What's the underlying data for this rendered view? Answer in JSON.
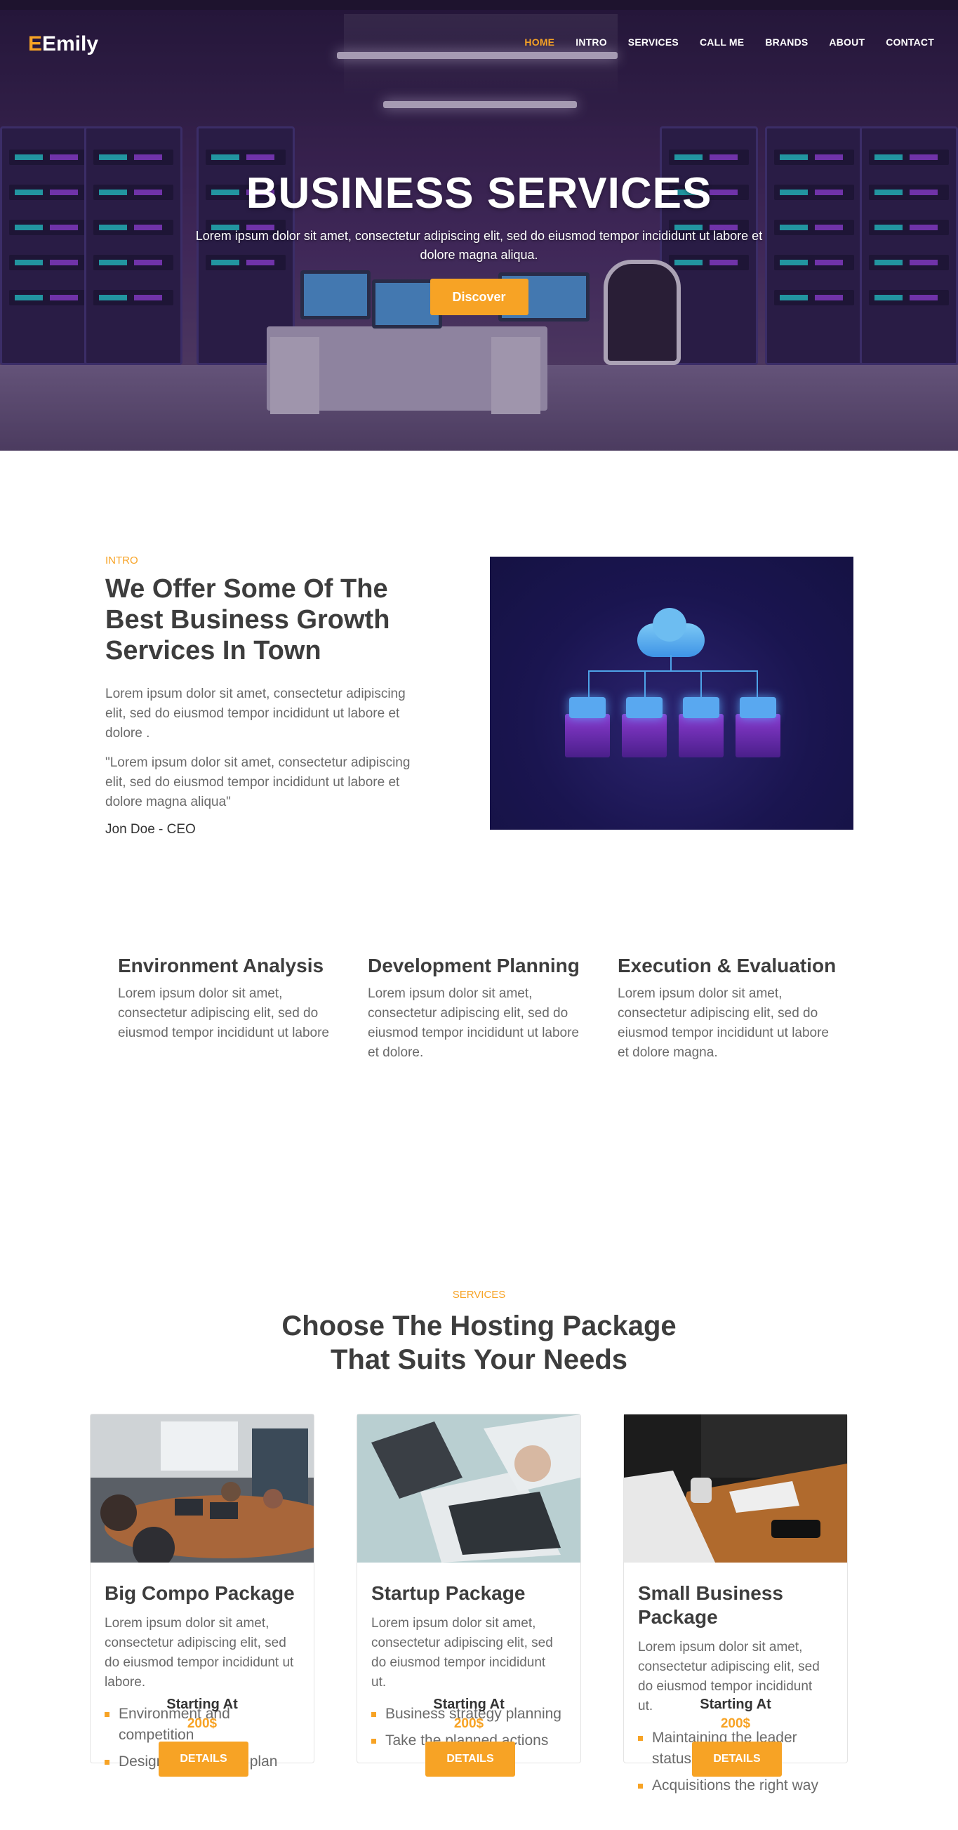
{
  "header": {
    "logo_letter": "E",
    "logo_text": "Emily",
    "nav": [
      "HOME",
      "INTRO",
      "SERVICES",
      "CALL ME",
      "BRANDS",
      "ABOUT",
      "CONTACT"
    ]
  },
  "hero": {
    "title": "BUSINESS SERVICES",
    "text": "Lorem ipsum dolor sit amet, consectetur adipiscing elit, sed do eiusmod tempor incididunt ut labore et dolore magna aliqua.",
    "button": "Discover"
  },
  "intro": {
    "eyebrow": "INTRO",
    "title": "We Offer Some Of The Best Business Growth Services In Town",
    "paragraph": "Lorem ipsum dolor sit amet, consectetur adipiscing elit, sed do eiusmod tempor incididunt ut labore et dolore .",
    "quote": "\"Lorem ipsum dolor sit amet, consectetur adipiscing elit, sed do eiusmod tempor incididunt ut labore et dolore magna aliqua\"",
    "author": "Jon Doe - CEO"
  },
  "features": [
    {
      "title": "Environment Analysis",
      "text": "Lorem ipsum dolor sit amet, consectetur adipiscing elit, sed do eiusmod tempor incididunt ut labore"
    },
    {
      "title": "Development Planning",
      "text": "Lorem ipsum dolor sit amet, consectetur adipiscing elit, sed do eiusmod tempor incididunt ut labore et dolore."
    },
    {
      "title": "Execution & Evaluation",
      "text": "Lorem ipsum dolor sit amet, consectetur adipiscing elit, sed do eiusmod tempor incididunt ut labore et dolore magna."
    }
  ],
  "services": {
    "eyebrow": "SERVICES",
    "title_line1": "Choose The Hosting Package",
    "title_line2": "That Suits Your Needs",
    "cards": [
      {
        "title": "Big Compo Package",
        "desc": "Lorem ipsum dolor sit amet, consectetur adipiscing elit, sed do eiusmod tempor incididunt ut labore.",
        "items": [
          "Environment and competition",
          "Design a marketing plan"
        ],
        "starting": "Starting At",
        "price": "200$",
        "button": "DETAILS"
      },
      {
        "title": "Startup Package",
        "desc": "Lorem ipsum dolor sit amet, consectetur adipiscing elit, sed do eiusmod tempor incididunt ut.",
        "items": [
          "Business strategy planning",
          "Take the planned actions"
        ],
        "starting": "Starting At",
        "price": "200$",
        "button": "DETAILS"
      },
      {
        "title": "Small Business Package",
        "desc": "Lorem ipsum dolor sit amet, consectetur adipiscing elit, sed do eiusmod tempor incididunt ut.",
        "items": [
          "Maintaining the leader status",
          "Acquisitions the right way"
        ],
        "starting": "Starting At",
        "price": "200$",
        "button": "DETAILS"
      }
    ]
  },
  "colors": {
    "accent": "#f7a325",
    "heading": "#3d3d3d",
    "body_text": "#6a6a6a"
  },
  "icons": [
    "cloud-server-illustration",
    "server-room-illustration"
  ]
}
